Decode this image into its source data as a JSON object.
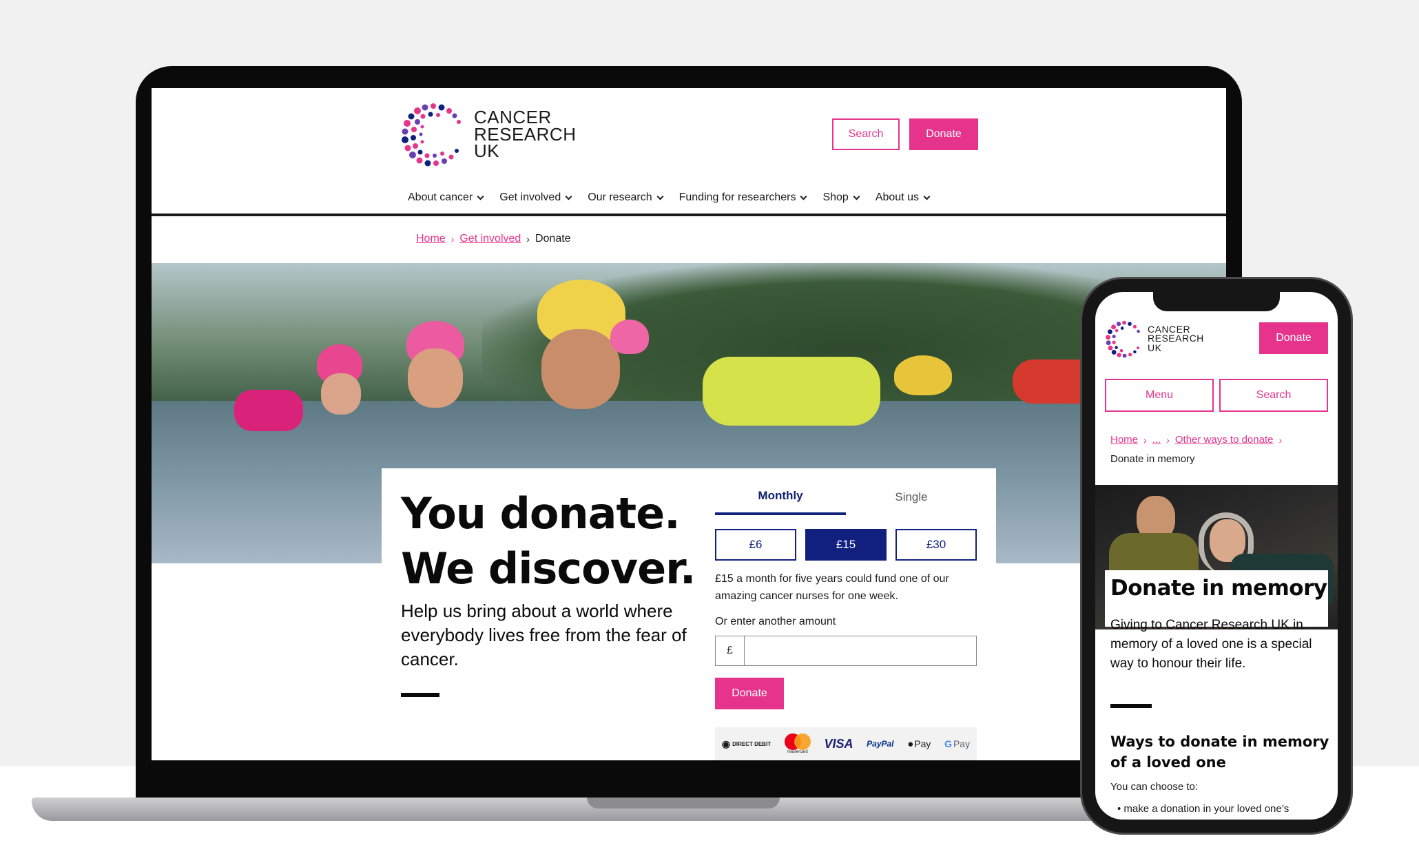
{
  "brand": {
    "logo_text": [
      "CANCER",
      "RESEARCH",
      "UK"
    ],
    "accent": "#e6348c",
    "navy": "#11207f"
  },
  "laptop": {
    "header": {
      "search_label": "Search",
      "donate_label": "Donate"
    },
    "nav": [
      {
        "label": "About cancer"
      },
      {
        "label": "Get involved"
      },
      {
        "label": "Our research"
      },
      {
        "label": "Funding for researchers"
      },
      {
        "label": "Shop"
      },
      {
        "label": "About us"
      }
    ],
    "breadcrumb": {
      "home": "Home",
      "get_involved": "Get involved",
      "current": "Donate"
    },
    "hero": {
      "headline_line1": "You donate.",
      "headline_line2": "We discover.",
      "subhead": "Help us bring about a world where everybody lives free from the fear of cancer."
    },
    "donate_form": {
      "tab_monthly": "Monthly",
      "tab_single": "Single",
      "amounts": [
        "£6",
        "£15",
        "£30"
      ],
      "selected_amount": "£15",
      "note": "£15 a month for five years could fund one of our amazing cancer nurses for one week.",
      "other_amount_label": "Or enter another amount",
      "currency_symbol": "£",
      "amount_value": "",
      "submit_label": "Donate"
    },
    "payments": {
      "direct_debit": "DIRECT DEBIT",
      "mastercard": "mastercard",
      "visa": "VISA",
      "paypal": "PayPal",
      "apple_pay": "Pay",
      "google_pay": "Pay"
    }
  },
  "phone": {
    "header": {
      "donate_label": "Donate",
      "menu_label": "Menu",
      "search_label": "Search"
    },
    "breadcrumb": {
      "home": "Home",
      "ellipsis": "...",
      "parent": "Other ways to donate",
      "current": "Donate in memory"
    },
    "title": "Donate in memory",
    "intro": "Giving to Cancer Research UK in memory of a loved one is a special way to honour their life.",
    "section_heading": "Ways to donate in memory of a loved one",
    "section_text": "You can choose to:",
    "list_item": "make a donation in your loved one’s"
  }
}
